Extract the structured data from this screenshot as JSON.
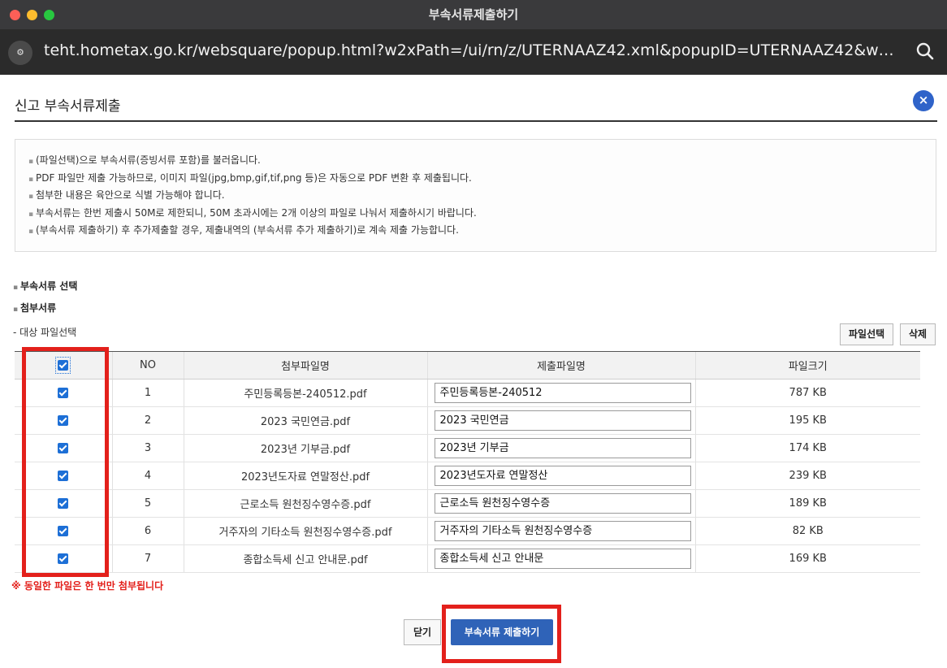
{
  "window": {
    "title": "부속서류제출하기"
  },
  "urlbar": {
    "site_icon": "site-settings-icon",
    "url": "teht.hometax.go.kr/websquare/popup.html?w2xPath=/ui/rn/z/UTERNAAZ42.xml&popupID=UTERNAAZ42&w…"
  },
  "header": {
    "title": "신고 부속서류제출",
    "close_label": "×"
  },
  "notice": {
    "items": [
      "(파일선택)으로 부속서류(증빙서류 포함)를 불러옵니다.",
      "PDF 파일만 제출 가능하므로, 이미지 파일(jpg,bmp,gif,tif,png 등)은 자동으로 PDF 변환 후 제출됩니다.",
      "첨부한 내용은 육안으로 식별 가능해야 합니다.",
      "부속서류는 한번 제출시 50M로 제한되니, 50M 초과시에는 2개 이상의 파일로 나눠서 제출하시기 바랍니다.",
      "(부속서류 제출하기) 후 추가제출할 경우, 제출내역의 (부속서류 추가 제출하기)로 계속 제출 가능합니다."
    ]
  },
  "sections": {
    "select": "부속서류 선택",
    "attach": "첨부서류",
    "target": "- 대상 파일선택"
  },
  "toolbar": {
    "file_select": "파일선택",
    "delete": "삭제"
  },
  "table": {
    "headers": [
      "NO",
      "첨부파일명",
      "제출파일명",
      "파일크기"
    ],
    "rows": [
      {
        "no": "1",
        "attach": "주민등록등본-240512.pdf",
        "submit": "주민등록등본-240512",
        "size": "787 KB"
      },
      {
        "no": "2",
        "attach": "2023 국민연금.pdf",
        "submit": "2023 국민연금",
        "size": "195 KB"
      },
      {
        "no": "3",
        "attach": "2023년 기부금.pdf",
        "submit": "2023년 기부금",
        "size": "174 KB"
      },
      {
        "no": "4",
        "attach": "2023년도자료 연말정산.pdf",
        "submit": "2023년도자료 연말정산",
        "size": "239 KB"
      },
      {
        "no": "5",
        "attach": "근로소득 원천징수영수증.pdf",
        "submit": "근로소득 원천징수영수증",
        "size": "189 KB"
      },
      {
        "no": "6",
        "attach": "거주자의 기타소득 원천징수영수증.pdf",
        "submit": "거주자의 기타소득 원천징수영수증",
        "size": "82 KB"
      },
      {
        "no": "7",
        "attach": "종합소득세 신고 안내문.pdf",
        "submit": "종합소득세 신고 안내문",
        "size": "169 KB"
      }
    ]
  },
  "warning": "※ 동일한 파일은 한 번만 첨부됩니다",
  "footer": {
    "close": "닫기",
    "submit": "부속서류 제출하기"
  },
  "colors": {
    "accent": "#2f63b8",
    "highlight": "#e3201b",
    "checkbox": "#1d6fd6"
  }
}
